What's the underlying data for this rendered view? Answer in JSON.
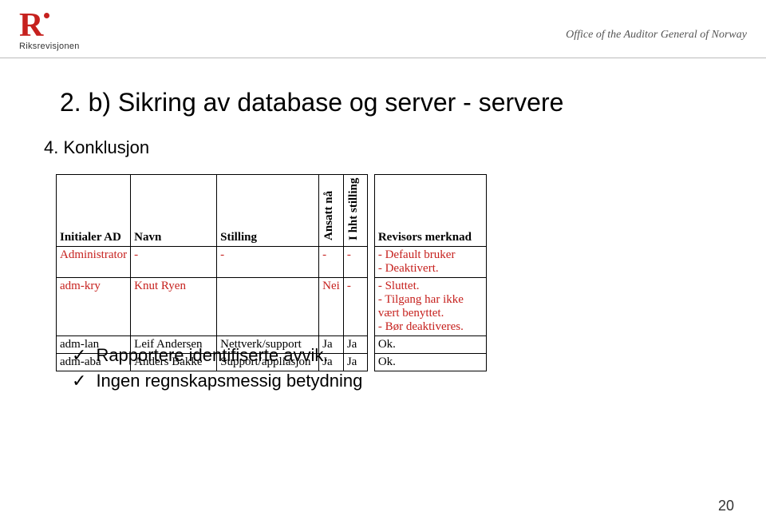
{
  "header": {
    "org_logo_letter": "R",
    "org_name": "Riksrevisjonen",
    "office_line": "Office of the Auditor General of Norway"
  },
  "title": "2. b) Sikring av database og server - servere",
  "subhead": "4. Konklusjon",
  "table": {
    "columns": {
      "initialer": "Initialer AD",
      "navn": "Navn",
      "stilling": "Stilling",
      "ansatt": "Ansatt nå",
      "hht": "I hht stilling",
      "merknad": "Revisors merknad"
    },
    "rows": [
      {
        "initialer": "Administrator",
        "navn": "-",
        "stilling": "-",
        "ansatt": "-",
        "hht": "-",
        "merknad": "- Default bruker\n- Deaktivert.",
        "red": true
      },
      {
        "initialer": "adm-kry",
        "navn": "Knut Ryen",
        "stilling": "",
        "ansatt": "Nei",
        "hht": "-",
        "merknad": "- Sluttet.\n- Tilgang har ikke vært benyttet.\n- Bør deaktiveres.",
        "red": true
      },
      {
        "initialer": "adm-lan",
        "navn": "Leif Andersen",
        "stilling": "Nettverk/support",
        "ansatt": "Ja",
        "hht": "Ja",
        "merknad": "Ok.",
        "red": false
      },
      {
        "initialer": "adm-aba",
        "navn": "Anders Bakke",
        "stilling": "Support/appliasjon",
        "ansatt": "Ja",
        "hht": "Ja",
        "merknad": "Ok.",
        "red": false
      }
    ]
  },
  "bullets": [
    "Rapportere identifiserte avvik.",
    "Ingen regnskapsmessig betydning"
  ],
  "page_number": "20"
}
